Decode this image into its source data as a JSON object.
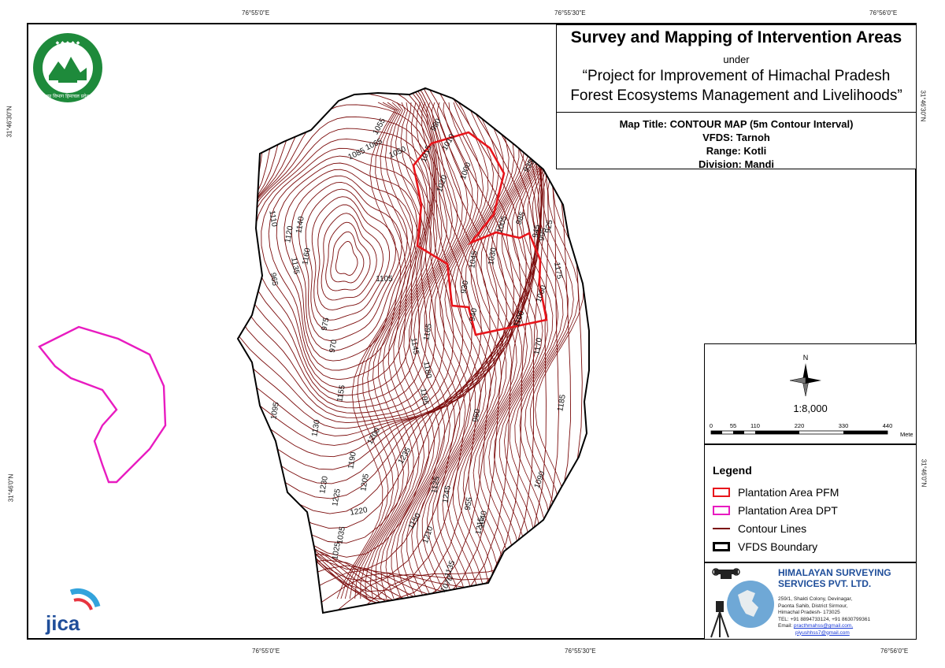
{
  "coordinates": {
    "top": [
      "76°55'0\"E",
      "76°55'30\"E",
      "76°56'0\"E"
    ],
    "bottom": [
      "76°55'0\"E",
      "76°55'30\"E",
      "76°56'0\"E"
    ],
    "left": [
      "31°46'30\"N",
      "31°46'0\"N"
    ],
    "right": [
      "31°46'30\"N",
      "31°46'0\"N"
    ]
  },
  "title_block": {
    "main": "Survey and Mapping of Intervention Areas",
    "under": "under",
    "project_line1": "“Project for Improvement of Himachal Pradesh",
    "project_line2": "Forest Ecosystems Management and Livelihoods”",
    "map_title": "Map Title: CONTOUR MAP (5m Contour Interval)",
    "vfds": "VFDS: Tarnoh",
    "range": "Range: Kotli",
    "division": "Division: Mandi"
  },
  "north_arrow_label": "N",
  "scale": {
    "ratio": "1:8,000",
    "ticks": [
      "0",
      "55",
      "110",
      "220",
      "330",
      "440"
    ],
    "unit": "Meters"
  },
  "legend": {
    "title": "Legend",
    "items": [
      {
        "label": "Plantation Area PFM",
        "color": "#e8151b",
        "style": "box"
      },
      {
        "label": "Plantation Area DPT",
        "color": "#e81bc0",
        "style": "box"
      },
      {
        "label": "Contour Lines",
        "color": "#7a0a0a",
        "style": "line"
      },
      {
        "label": "VFDS Boundary",
        "color": "#000000",
        "style": "box"
      }
    ]
  },
  "company": {
    "name_line1": "HIMALAYAN SURVEYING",
    "name_line2": "SERVICES PVT. LTD.",
    "address": [
      "259/1, Shakti Colony, Devinagar,",
      "Paonta Sahib, District Sirmour,",
      "Himachal Pradesh- 173025",
      "TEL: +91 8894733124, +91 8630799361"
    ],
    "email_label": "Email:",
    "email1": "practhmahss@gmail.com,",
    "email2": "piyushhss7@gmail.com"
  },
  "logos": {
    "forest_dept_text": "वन विभाग हिमाचल प्रदेश",
    "jica": "JICA"
  },
  "contour_labels": [
    "1055",
    "980",
    "1010",
    "1065",
    "1050",
    "1015",
    "1085",
    "1020",
    "1000",
    "935",
    "1110",
    "1140",
    "1120",
    "1005",
    "985",
    "945",
    "925",
    "1135",
    "1160",
    "1045",
    "1030",
    "995",
    "965",
    "1105",
    "1175",
    "930",
    "1060",
    "940",
    "1100",
    "975",
    "1165",
    "1145",
    "1170",
    "970",
    "1180",
    "1155",
    "1195",
    "1185",
    "960",
    "1095",
    "1130",
    "1200",
    "1235",
    "1190",
    "1230",
    "1205",
    "1225",
    "1125",
    "1220",
    "1245",
    "1090",
    "955",
    "1040",
    "1035",
    "1215",
    "1150",
    "1025",
    "1210",
    "1135",
    "1070",
    "950"
  ],
  "colors": {
    "contour": "#7a0a0a",
    "pfm": "#e8151b",
    "dpt": "#e81bc0",
    "boundary": "#000000",
    "company_blue": "#1f4e9a"
  }
}
